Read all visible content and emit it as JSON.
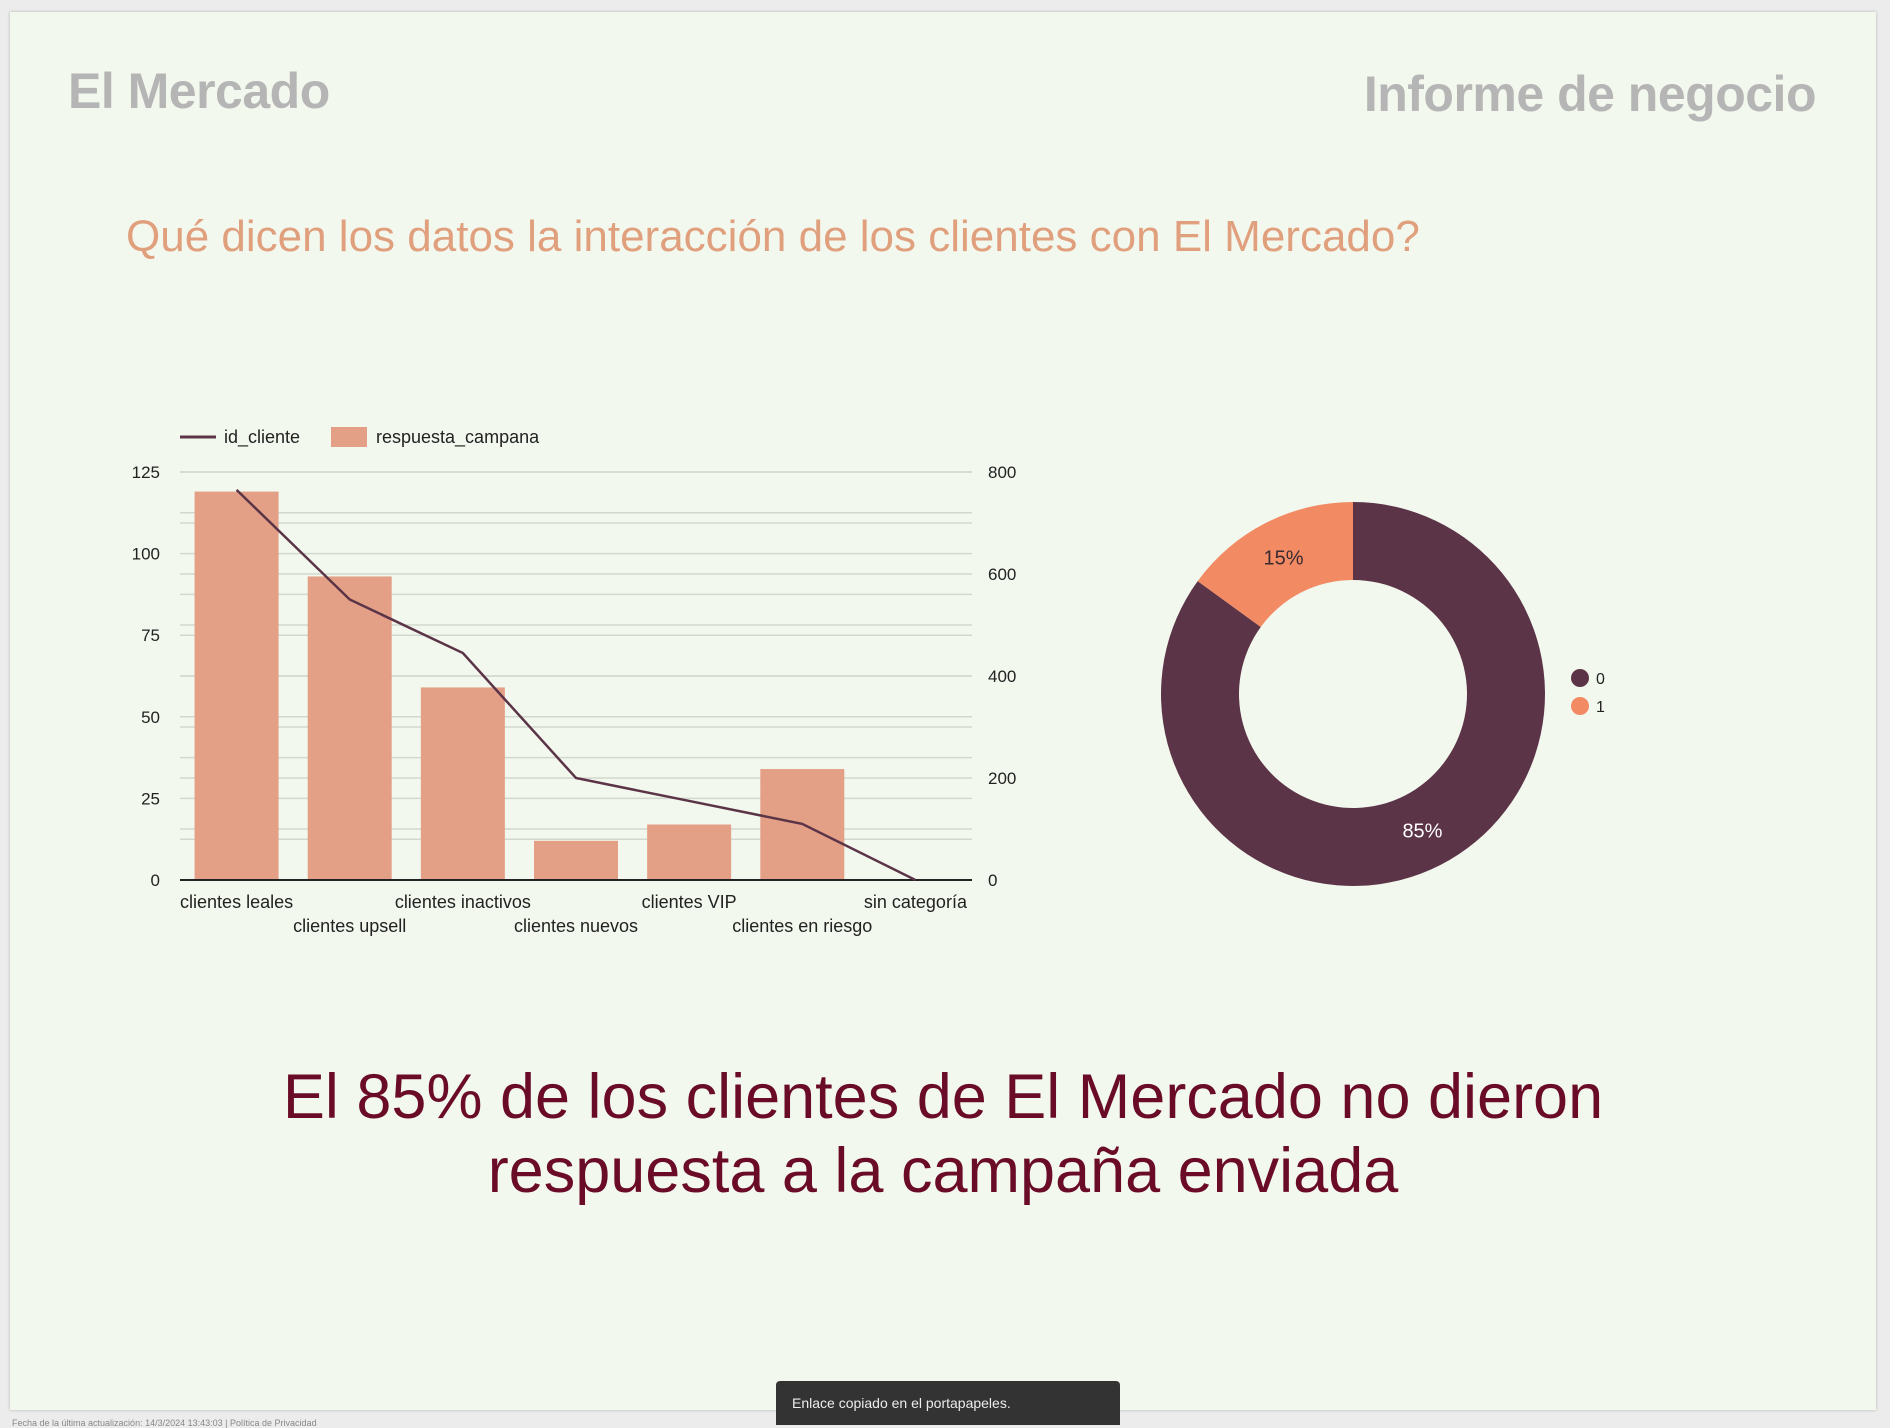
{
  "header": {
    "brand": "El Mercado",
    "report_title": "Informe de negocio"
  },
  "question": "Qué dicen los datos la interacción de los clientes con El Mercado?",
  "conclusion": {
    "line1": "El 85% de los clientes de El Mercado no dieron",
    "line2": "respuesta a la campaña enviada"
  },
  "toast": "Enlace copiado en el portapapeles.",
  "footer": {
    "updated": "Fecha de la última actualización: 14/3/2024 13:43:03",
    "separator": "|",
    "privacy": "Política de Privacidad"
  },
  "colors": {
    "bar": "#e3a086",
    "line": "#5c3448",
    "donut_0": "#5c3448",
    "donut_1": "#f28a63",
    "question": "#e0a07e",
    "conclusion": "#6a0c28"
  },
  "chart_data": [
    {
      "type": "bar",
      "combo": "bar+line",
      "categories": [
        "clientes leales",
        "clientes upsell",
        "clientes inactivos",
        "clientes nuevos",
        "clientes VIP",
        "clientes en riesgo",
        "sin categoría"
      ],
      "series": [
        {
          "name": "respuesta_campana",
          "type": "bar",
          "axis": "left",
          "values": [
            119,
            93,
            59,
            12,
            17,
            34,
            0
          ]
        },
        {
          "name": "id_cliente",
          "type": "line",
          "axis": "right",
          "values": [
            765,
            550,
            445,
            200,
            155,
            110,
            0
          ]
        }
      ],
      "y_left": {
        "ticks": [
          0,
          25,
          50,
          75,
          100,
          125
        ],
        "ylim": [
          0,
          125
        ]
      },
      "y_right": {
        "ticks": [
          0,
          200,
          400,
          600,
          800
        ],
        "ylim": [
          0,
          800
        ]
      },
      "legend": "top-left",
      "grid": true
    },
    {
      "type": "pie",
      "donut": true,
      "labels": [
        "0",
        "1"
      ],
      "values": [
        85,
        15
      ],
      "data_labels": [
        "85%",
        "15%"
      ],
      "legend": "right"
    }
  ]
}
